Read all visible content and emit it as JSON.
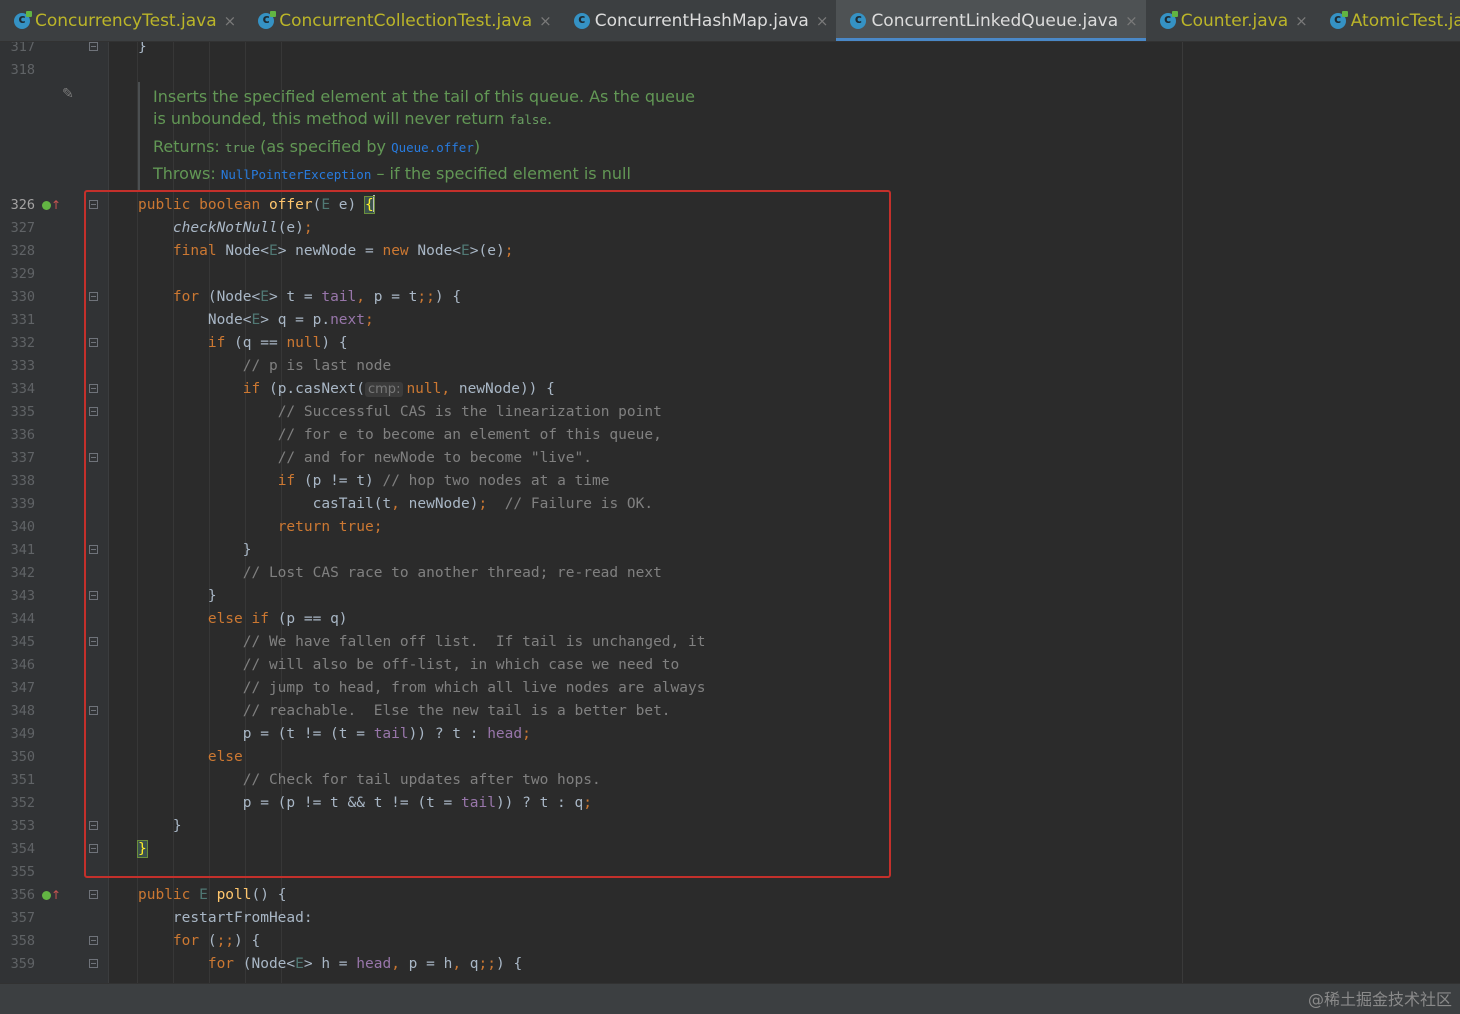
{
  "tabs": [
    {
      "label": "ConcurrencyTest.java",
      "active": false
    },
    {
      "label": "ConcurrentCollectionTest.java",
      "active": false
    },
    {
      "label": "ConcurrentHashMap.java",
      "active": false
    },
    {
      "label": "ConcurrentLinkedQueue.java",
      "active": true
    },
    {
      "label": "Counter.java",
      "active": false
    },
    {
      "label": "AtomicTest.java",
      "active": false
    }
  ],
  "javadoc": {
    "desc": "Inserts the specified element at the tail of this queue. As the queue is unbounded, this method will never return",
    "desc_code": "false",
    "desc_end": ".",
    "returns_label": "Returns:",
    "returns_code": "true",
    "returns_text_1": "(as specified by",
    "returns_link": "Queue.offer",
    "returns_text_2": ")",
    "throws_label": "Throws:",
    "throws_link": "NullPointerException",
    "throws_text": "– if the specified element is null"
  },
  "code_lines": [
    {
      "ln": "317",
      "t": [
        [
          "p",
          "}"
        ]
      ]
    },
    {
      "ln": "318",
      "t": []
    },
    {
      "ln": "326",
      "t": [
        [
          "k",
          "public boolean "
        ],
        [
          "f",
          "offer"
        ],
        [
          "p",
          "("
        ],
        [
          "tp",
          "E"
        ],
        [
          "p",
          " e) "
        ],
        [
          "bh",
          "{"
        ]
      ]
    },
    {
      "ln": "327",
      "t": [
        [
          "p",
          "    "
        ],
        [
          "it",
          "checkNotNull"
        ],
        [
          "p",
          "(e)"
        ],
        [
          "k",
          ";"
        ]
      ]
    },
    {
      "ln": "328",
      "t": [
        [
          "p",
          "    "
        ],
        [
          "k",
          "final "
        ],
        [
          "p",
          "Node<"
        ],
        [
          "tp",
          "E"
        ],
        [
          "p",
          "> newNode = "
        ],
        [
          "k",
          "new "
        ],
        [
          "p",
          "Node<"
        ],
        [
          "tp",
          "E"
        ],
        [
          "p",
          ">(e)"
        ],
        [
          "k",
          ";"
        ]
      ]
    },
    {
      "ln": "329",
      "t": []
    },
    {
      "ln": "330",
      "t": [
        [
          "p",
          "    "
        ],
        [
          "k",
          "for "
        ],
        [
          "p",
          "(Node<"
        ],
        [
          "tp",
          "E"
        ],
        [
          "p",
          "> t = "
        ],
        [
          "fi",
          "tail"
        ],
        [
          "k",
          ", "
        ],
        [
          "p",
          "p = t"
        ],
        [
          "k",
          ";;"
        ],
        [
          "p",
          ") {"
        ]
      ]
    },
    {
      "ln": "331",
      "t": [
        [
          "p",
          "        Node<"
        ],
        [
          "tp",
          "E"
        ],
        [
          "p",
          "> q = p."
        ],
        [
          "fi",
          "next"
        ],
        [
          "k",
          ";"
        ]
      ]
    },
    {
      "ln": "332",
      "t": [
        [
          "p",
          "        "
        ],
        [
          "k",
          "if "
        ],
        [
          "p",
          "(q == "
        ],
        [
          "k",
          "null"
        ],
        [
          "p",
          ") {"
        ]
      ]
    },
    {
      "ln": "333",
      "t": [
        [
          "p",
          "            "
        ],
        [
          "c",
          "// p is last node"
        ]
      ]
    },
    {
      "ln": "334",
      "t": [
        [
          "p",
          "            "
        ],
        [
          "k",
          "if "
        ],
        [
          "p",
          "(p.casNext("
        ],
        [
          "hint",
          "cmp:"
        ],
        [
          "k",
          "null, "
        ],
        [
          "p",
          "newNode)) {"
        ]
      ]
    },
    {
      "ln": "335",
      "t": [
        [
          "p",
          "                "
        ],
        [
          "c",
          "// Successful CAS is the linearization point"
        ]
      ]
    },
    {
      "ln": "336",
      "t": [
        [
          "p",
          "                "
        ],
        [
          "c",
          "// for e to become an element of this queue,"
        ]
      ]
    },
    {
      "ln": "337",
      "t": [
        [
          "p",
          "                "
        ],
        [
          "c",
          "// and for newNode to become \"live\"."
        ]
      ]
    },
    {
      "ln": "338",
      "t": [
        [
          "p",
          "                "
        ],
        [
          "k",
          "if "
        ],
        [
          "p",
          "(p != t) "
        ],
        [
          "c",
          "// hop two nodes at a time"
        ]
      ]
    },
    {
      "ln": "339",
      "t": [
        [
          "p",
          "                    casTail(t"
        ],
        [
          "k",
          ", "
        ],
        [
          "p",
          "newNode)"
        ],
        [
          "k",
          ";  "
        ],
        [
          "c",
          "// Failure is OK."
        ]
      ]
    },
    {
      "ln": "340",
      "t": [
        [
          "p",
          "                "
        ],
        [
          "k",
          "return true;"
        ]
      ]
    },
    {
      "ln": "341",
      "t": [
        [
          "p",
          "            }"
        ]
      ]
    },
    {
      "ln": "342",
      "t": [
        [
          "p",
          "            "
        ],
        [
          "c",
          "// Lost CAS race to another thread; re-read next"
        ]
      ]
    },
    {
      "ln": "343",
      "t": [
        [
          "p",
          "        }"
        ]
      ]
    },
    {
      "ln": "344",
      "t": [
        [
          "p",
          "        "
        ],
        [
          "k",
          "else if "
        ],
        [
          "p",
          "(p == q)"
        ]
      ]
    },
    {
      "ln": "345",
      "t": [
        [
          "p",
          "            "
        ],
        [
          "c",
          "// We have fallen off list.  If tail is unchanged, it"
        ]
      ]
    },
    {
      "ln": "346",
      "t": [
        [
          "p",
          "            "
        ],
        [
          "c",
          "// will also be off-list, in which case we need to"
        ]
      ]
    },
    {
      "ln": "347",
      "t": [
        [
          "p",
          "            "
        ],
        [
          "c",
          "// jump to head, from which all live nodes are always"
        ]
      ]
    },
    {
      "ln": "348",
      "t": [
        [
          "p",
          "            "
        ],
        [
          "c",
          "// reachable.  Else the new tail is a better bet."
        ]
      ]
    },
    {
      "ln": "349",
      "t": [
        [
          "p",
          "            p = (t != (t = "
        ],
        [
          "fi",
          "tail"
        ],
        [
          "p",
          ")) ? t : "
        ],
        [
          "fi",
          "head"
        ],
        [
          "k",
          ";"
        ]
      ]
    },
    {
      "ln": "350",
      "t": [
        [
          "p",
          "        "
        ],
        [
          "k",
          "else"
        ]
      ]
    },
    {
      "ln": "351",
      "t": [
        [
          "p",
          "            "
        ],
        [
          "c",
          "// Check for tail updates after two hops."
        ]
      ]
    },
    {
      "ln": "352",
      "t": [
        [
          "p",
          "            p = (p != t && t != (t = "
        ],
        [
          "fi",
          "tail"
        ],
        [
          "p",
          ")) ? t : q"
        ],
        [
          "k",
          ";"
        ]
      ]
    },
    {
      "ln": "353",
      "t": [
        [
          "p",
          "    }"
        ]
      ]
    },
    {
      "ln": "354",
      "t": [
        [
          "bh",
          "}"
        ]
      ]
    },
    {
      "ln": "355",
      "t": []
    },
    {
      "ln": "356",
      "t": [
        [
          "k",
          "public "
        ],
        [
          "tp",
          "E "
        ],
        [
          "f",
          "poll"
        ],
        [
          "p",
          "() {"
        ]
      ]
    },
    {
      "ln": "357",
      "t": [
        [
          "p",
          "    restartFromHead:"
        ]
      ]
    },
    {
      "ln": "358",
      "t": [
        [
          "p",
          "    "
        ],
        [
          "k",
          "for "
        ],
        [
          "p",
          "("
        ],
        [
          "k",
          ";;"
        ],
        [
          "p",
          ") {"
        ]
      ]
    },
    {
      "ln": "359",
      "t": [
        [
          "p",
          "        "
        ],
        [
          "k",
          "for "
        ],
        [
          "p",
          "(Node<"
        ],
        [
          "tp",
          "E"
        ],
        [
          "p",
          "> h = "
        ],
        [
          "fi",
          "head"
        ],
        [
          "k",
          ", "
        ],
        [
          "p",
          "p = h"
        ],
        [
          "k",
          ", "
        ],
        [
          "p",
          "q"
        ],
        [
          "k",
          ";;"
        ],
        [
          "p",
          ") {"
        ]
      ]
    }
  ],
  "watermark": "@稀土掘金技术社区"
}
